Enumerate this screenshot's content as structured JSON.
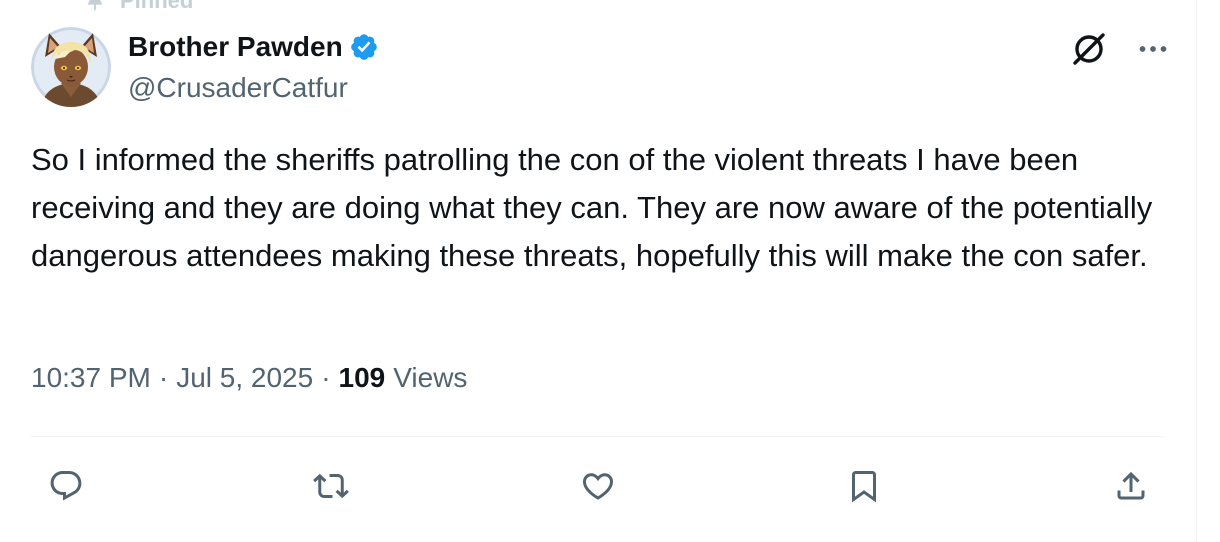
{
  "pinned": {
    "label": "Pinned"
  },
  "author": {
    "display_name": "Brother Pawden",
    "handle": "@CrusaderCatfur",
    "verified": true
  },
  "tweet": {
    "text": "So I informed the sheriffs patrolling the con of the violent threats I have been receiving and they are doing what they can. They are now aware of the potentially dangerous attendees making these threats, hopefully this will make the con safer."
  },
  "meta": {
    "time": "10:37 PM",
    "separator": "·",
    "date": "Jul 5, 2025",
    "views_count": "109",
    "views_label": "Views"
  },
  "icons": {
    "pin": "pin-icon",
    "verified": "verified-badge-icon",
    "grok": "grok-icon",
    "more": "more-horizontal-icon",
    "reply": "reply-icon",
    "retweet": "retweet-icon",
    "like": "heart-icon",
    "bookmark": "bookmark-icon",
    "share": "share-icon"
  },
  "colors": {
    "text_primary": "#0f1419",
    "text_secondary": "#536471",
    "verified_blue": "#1d9bf0",
    "divider": "#eff3f4"
  }
}
